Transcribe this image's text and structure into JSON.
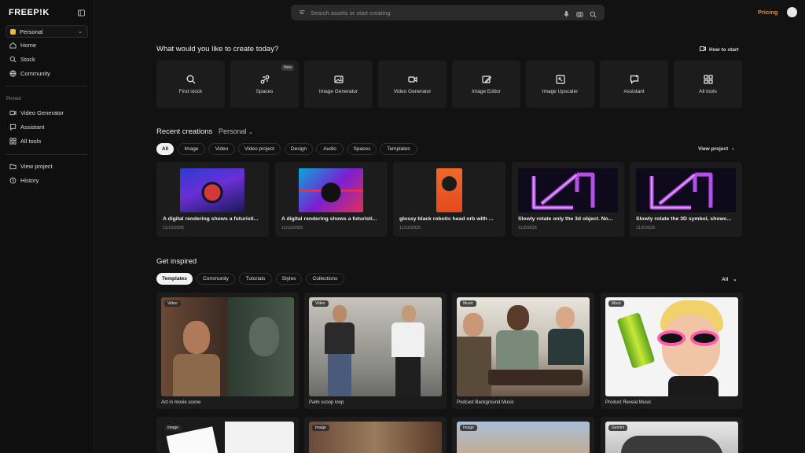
{
  "sidebar": {
    "logo": "FREEP!K",
    "workspace": "Personal",
    "nav": [
      {
        "label": "Home",
        "icon": "home-icon"
      },
      {
        "label": "Stock",
        "icon": "stock-icon"
      },
      {
        "label": "Community",
        "icon": "globe-icon"
      }
    ],
    "pinned_heading": "Pinned",
    "pinned": [
      {
        "label": "Video Generator",
        "icon": "video-icon"
      },
      {
        "label": "Assistant",
        "icon": "chat-icon"
      },
      {
        "label": "All tools",
        "icon": "grid-icon"
      }
    ],
    "bottom": [
      {
        "label": "View project",
        "icon": "folder-icon"
      },
      {
        "label": "History",
        "icon": "history-icon"
      }
    ]
  },
  "topbar": {
    "search_placeholder": "Search assets or start creating",
    "pricing": "Pricing",
    "accent": "#f08a3a"
  },
  "main": {
    "create_title": "What would you like to create today?",
    "how_to_start": "How to start",
    "tools": [
      {
        "label": "Find stock",
        "icon": "search-icon"
      },
      {
        "label": "Spaces",
        "icon": "spaces-icon",
        "badge": "New"
      },
      {
        "label": "Image Generator",
        "icon": "image-icon"
      },
      {
        "label": "Video Generator",
        "icon": "video-icon"
      },
      {
        "label": "Image Editor",
        "icon": "edit-icon"
      },
      {
        "label": "Image Upscaler",
        "icon": "upscale-icon"
      },
      {
        "label": "Assistant",
        "icon": "chat-icon"
      },
      {
        "label": "All tools",
        "icon": "grid-icon"
      }
    ],
    "recent_title": "Recent creations",
    "recent_filter": "Personal",
    "recent_tabs": [
      "All",
      "Image",
      "Video",
      "Video project",
      "Design",
      "Audio",
      "Spaces",
      "Templates"
    ],
    "view_project": "View project",
    "creations": [
      {
        "caption": "A digital rendering shows a futuristi...",
        "date": "11/12/2025"
      },
      {
        "caption": "A digital rendering shows a futuristi...",
        "date": "11/12/2025"
      },
      {
        "caption": "glossy black robotic head orb with ...",
        "date": "11/12/2025"
      },
      {
        "caption": "Slowly rotate only the 3d object. No...",
        "date": "11/2/2025"
      },
      {
        "caption": "Slowly rotate the 3D symbol, showc...",
        "date": "11/2/2025"
      }
    ],
    "inspired_title": "Get inspired",
    "inspired_tabs": [
      "Templates",
      "Community",
      "Tutorials",
      "Styles",
      "Collections"
    ],
    "inspired_filter": "All",
    "inspired": [
      {
        "tag": "Video",
        "caption": "Act in movie scene"
      },
      {
        "tag": "Video",
        "caption": "Palm scoop loop"
      },
      {
        "tag": "Music",
        "caption": "Podcast Background Music"
      },
      {
        "tag": "Mock",
        "caption": "Product Reveal Music"
      }
    ],
    "inspired_row2": [
      {
        "tag": "Image"
      },
      {
        "tag": "Image"
      },
      {
        "tag": "Image"
      },
      {
        "tag": "Gemini"
      }
    ]
  }
}
